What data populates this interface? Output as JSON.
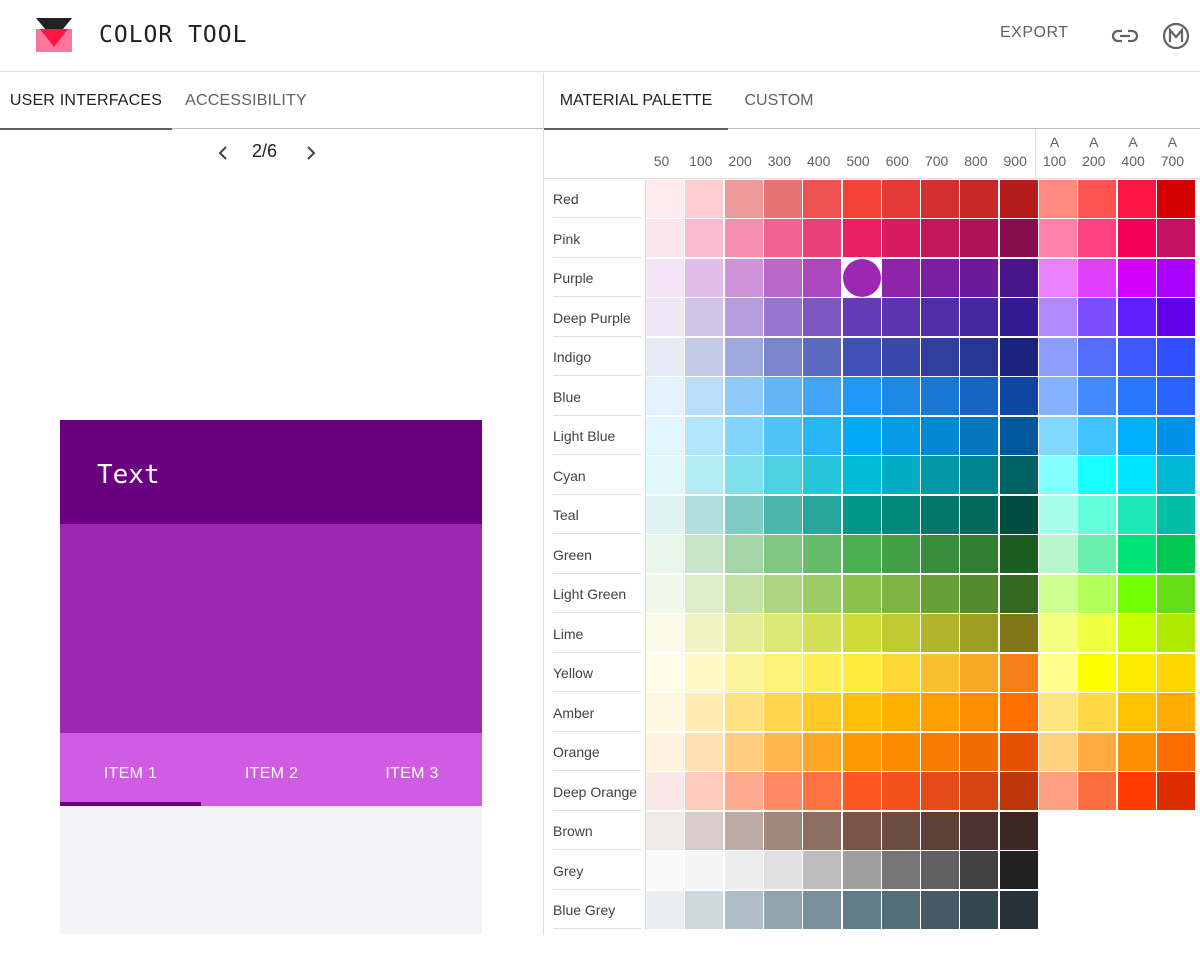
{
  "header": {
    "title": "COLOR TOOL",
    "export_label": "EXPORT",
    "icons": [
      "logo-icon",
      "link-icon",
      "material-m-icon"
    ]
  },
  "left": {
    "tabs": [
      {
        "label": "USER INTERFACES",
        "active": true
      },
      {
        "label": "ACCESSIBILITY",
        "active": false
      }
    ],
    "pager": {
      "text": "2/6"
    },
    "mockup": {
      "bar_text": "Text",
      "tabs": [
        "ITEM 1",
        "ITEM 2",
        "ITEM 3"
      ],
      "colors": {
        "bar": "#6a0080",
        "body": "#9c27b0",
        "tabs": "#d05ce3",
        "indicator": "#6a0080",
        "surface": "#f4f4f6"
      }
    }
  },
  "right": {
    "tabs": [
      {
        "label": "MATERIAL PALETTE",
        "active": true
      },
      {
        "label": "CUSTOM",
        "active": false
      }
    ],
    "columns": [
      {
        "top": "",
        "bottom": "50"
      },
      {
        "top": "",
        "bottom": "100"
      },
      {
        "top": "",
        "bottom": "200"
      },
      {
        "top": "",
        "bottom": "300"
      },
      {
        "top": "",
        "bottom": "400"
      },
      {
        "top": "",
        "bottom": "500"
      },
      {
        "top": "",
        "bottom": "600"
      },
      {
        "top": "",
        "bottom": "700"
      },
      {
        "top": "",
        "bottom": "800"
      },
      {
        "top": "",
        "bottom": "900"
      },
      {
        "top": "A",
        "bottom": "100"
      },
      {
        "top": "A",
        "bottom": "200"
      },
      {
        "top": "A",
        "bottom": "400"
      },
      {
        "top": "A",
        "bottom": "700"
      }
    ],
    "selected": {
      "row": "Purple",
      "shade": "500"
    },
    "rows": [
      {
        "name": "Red",
        "colors": [
          "#ffebee",
          "#ffcdd2",
          "#ef9a9a",
          "#e57373",
          "#ef5350",
          "#f44336",
          "#e53935",
          "#d32f2f",
          "#c62828",
          "#b71c1c",
          "#ff8a80",
          "#ff5252",
          "#ff1744",
          "#d50000"
        ]
      },
      {
        "name": "Pink",
        "colors": [
          "#fce4ec",
          "#f8bbd0",
          "#f48fb1",
          "#f06292",
          "#ec407a",
          "#e91e63",
          "#d81b60",
          "#c2185b",
          "#ad1457",
          "#880e4f",
          "#ff80ab",
          "#ff4081",
          "#f50057",
          "#c51162"
        ]
      },
      {
        "name": "Purple",
        "colors": [
          "#f3e5f5",
          "#e1bee7",
          "#ce93d8",
          "#ba68c8",
          "#ab47bc",
          "#9c27b0",
          "#8e24aa",
          "#7b1fa2",
          "#6a1b9a",
          "#4a148c",
          "#ea80fc",
          "#e040fb",
          "#d500f9",
          "#aa00ff"
        ]
      },
      {
        "name": "Deep Purple",
        "colors": [
          "#ede7f6",
          "#d1c4e9",
          "#b39ddb",
          "#9575cd",
          "#7e57c2",
          "#673ab7",
          "#5e35b1",
          "#512da8",
          "#4527a0",
          "#311b92",
          "#b388ff",
          "#7c4dff",
          "#651fff",
          "#6200ea"
        ]
      },
      {
        "name": "Indigo",
        "colors": [
          "#e8eaf6",
          "#c5cae9",
          "#9fa8da",
          "#7986cb",
          "#5c6bc0",
          "#3f51b5",
          "#3949ab",
          "#303f9f",
          "#283593",
          "#1a237e",
          "#8c9eff",
          "#536dfe",
          "#3d5afe",
          "#304ffe"
        ]
      },
      {
        "name": "Blue",
        "colors": [
          "#e3f2fd",
          "#bbdefb",
          "#90caf9",
          "#64b5f6",
          "#42a5f5",
          "#2196f3",
          "#1e88e5",
          "#1976d2",
          "#1565c0",
          "#0d47a1",
          "#82b1ff",
          "#448aff",
          "#2979ff",
          "#2962ff"
        ]
      },
      {
        "name": "Light Blue",
        "colors": [
          "#e1f5fe",
          "#b3e5fc",
          "#81d4fa",
          "#4fc3f7",
          "#29b6f6",
          "#03a9f4",
          "#039be5",
          "#0288d1",
          "#0277bd",
          "#01579b",
          "#80d8ff",
          "#40c4ff",
          "#00b0ff",
          "#0091ea"
        ]
      },
      {
        "name": "Cyan",
        "colors": [
          "#e0f7fa",
          "#b2ebf2",
          "#80deea",
          "#4dd0e1",
          "#26c6da",
          "#00bcd4",
          "#00acc1",
          "#0097a7",
          "#00838f",
          "#006064",
          "#84ffff",
          "#18ffff",
          "#00e5ff",
          "#00b8d4"
        ]
      },
      {
        "name": "Teal",
        "colors": [
          "#e0f2f1",
          "#b2dfdb",
          "#80cbc4",
          "#4db6ac",
          "#26a69a",
          "#009688",
          "#00897b",
          "#00796b",
          "#00695c",
          "#004d40",
          "#a7ffeb",
          "#64ffda",
          "#1de9b6",
          "#00bfa5"
        ]
      },
      {
        "name": "Green",
        "colors": [
          "#e8f5e9",
          "#c8e6c9",
          "#a5d6a7",
          "#81c784",
          "#66bb6a",
          "#4caf50",
          "#43a047",
          "#388e3c",
          "#2e7d32",
          "#1b5e20",
          "#b9f6ca",
          "#69f0ae",
          "#00e676",
          "#00c853"
        ]
      },
      {
        "name": "Light Green",
        "colors": [
          "#f1f8e9",
          "#dcedc8",
          "#c5e1a5",
          "#aed581",
          "#9ccc65",
          "#8bc34a",
          "#7cb342",
          "#689f38",
          "#558b2f",
          "#33691e",
          "#ccff90",
          "#b2ff59",
          "#76ff03",
          "#64dd17"
        ]
      },
      {
        "name": "Lime",
        "colors": [
          "#f9fbe7",
          "#f0f4c3",
          "#e6ee9c",
          "#dce775",
          "#d4e157",
          "#cddc39",
          "#c0ca33",
          "#afb42b",
          "#9e9d24",
          "#827717",
          "#f4ff81",
          "#eeff41",
          "#c6ff00",
          "#aeea00"
        ]
      },
      {
        "name": "Yellow",
        "colors": [
          "#fffde7",
          "#fff9c4",
          "#fff59d",
          "#fff176",
          "#ffee58",
          "#ffeb3b",
          "#fdd835",
          "#fbc02d",
          "#f9a825",
          "#f57f17",
          "#ffff8d",
          "#ffff00",
          "#ffea00",
          "#ffd600"
        ]
      },
      {
        "name": "Amber",
        "colors": [
          "#fff8e1",
          "#ffecb3",
          "#ffe082",
          "#ffd54f",
          "#ffca28",
          "#ffc107",
          "#ffb300",
          "#ffa000",
          "#ff8f00",
          "#ff6f00",
          "#ffe57f",
          "#ffd740",
          "#ffc400",
          "#ffab00"
        ]
      },
      {
        "name": "Orange",
        "colors": [
          "#fff3e0",
          "#ffe0b2",
          "#ffcc80",
          "#ffb74d",
          "#ffa726",
          "#ff9800",
          "#fb8c00",
          "#f57c00",
          "#ef6c00",
          "#e65100",
          "#ffd180",
          "#ffab40",
          "#ff9100",
          "#ff6d00"
        ]
      },
      {
        "name": "Deep Orange",
        "colors": [
          "#fbe9e7",
          "#ffccbc",
          "#ffab91",
          "#ff8a65",
          "#ff7043",
          "#ff5722",
          "#f4511e",
          "#e64a19",
          "#d84315",
          "#bf360c",
          "#ff9e80",
          "#ff6e40",
          "#ff3d00",
          "#dd2c00"
        ]
      },
      {
        "name": "Brown",
        "colors": [
          "#efebe9",
          "#d7ccc8",
          "#bcaaa4",
          "#a1887f",
          "#8d6e63",
          "#795548",
          "#6d4c41",
          "#5d4037",
          "#4e342e",
          "#3e2723"
        ]
      },
      {
        "name": "Grey",
        "colors": [
          "#fafafa",
          "#f5f5f5",
          "#eeeeee",
          "#e0e0e0",
          "#bdbdbd",
          "#9e9e9e",
          "#757575",
          "#616161",
          "#424242",
          "#212121"
        ]
      },
      {
        "name": "Blue Grey",
        "colors": [
          "#eceff1",
          "#cfd8dc",
          "#b0bec5",
          "#90a4ae",
          "#78909c",
          "#607d8b",
          "#546e7a",
          "#455a64",
          "#37474f",
          "#263238"
        ]
      }
    ]
  }
}
